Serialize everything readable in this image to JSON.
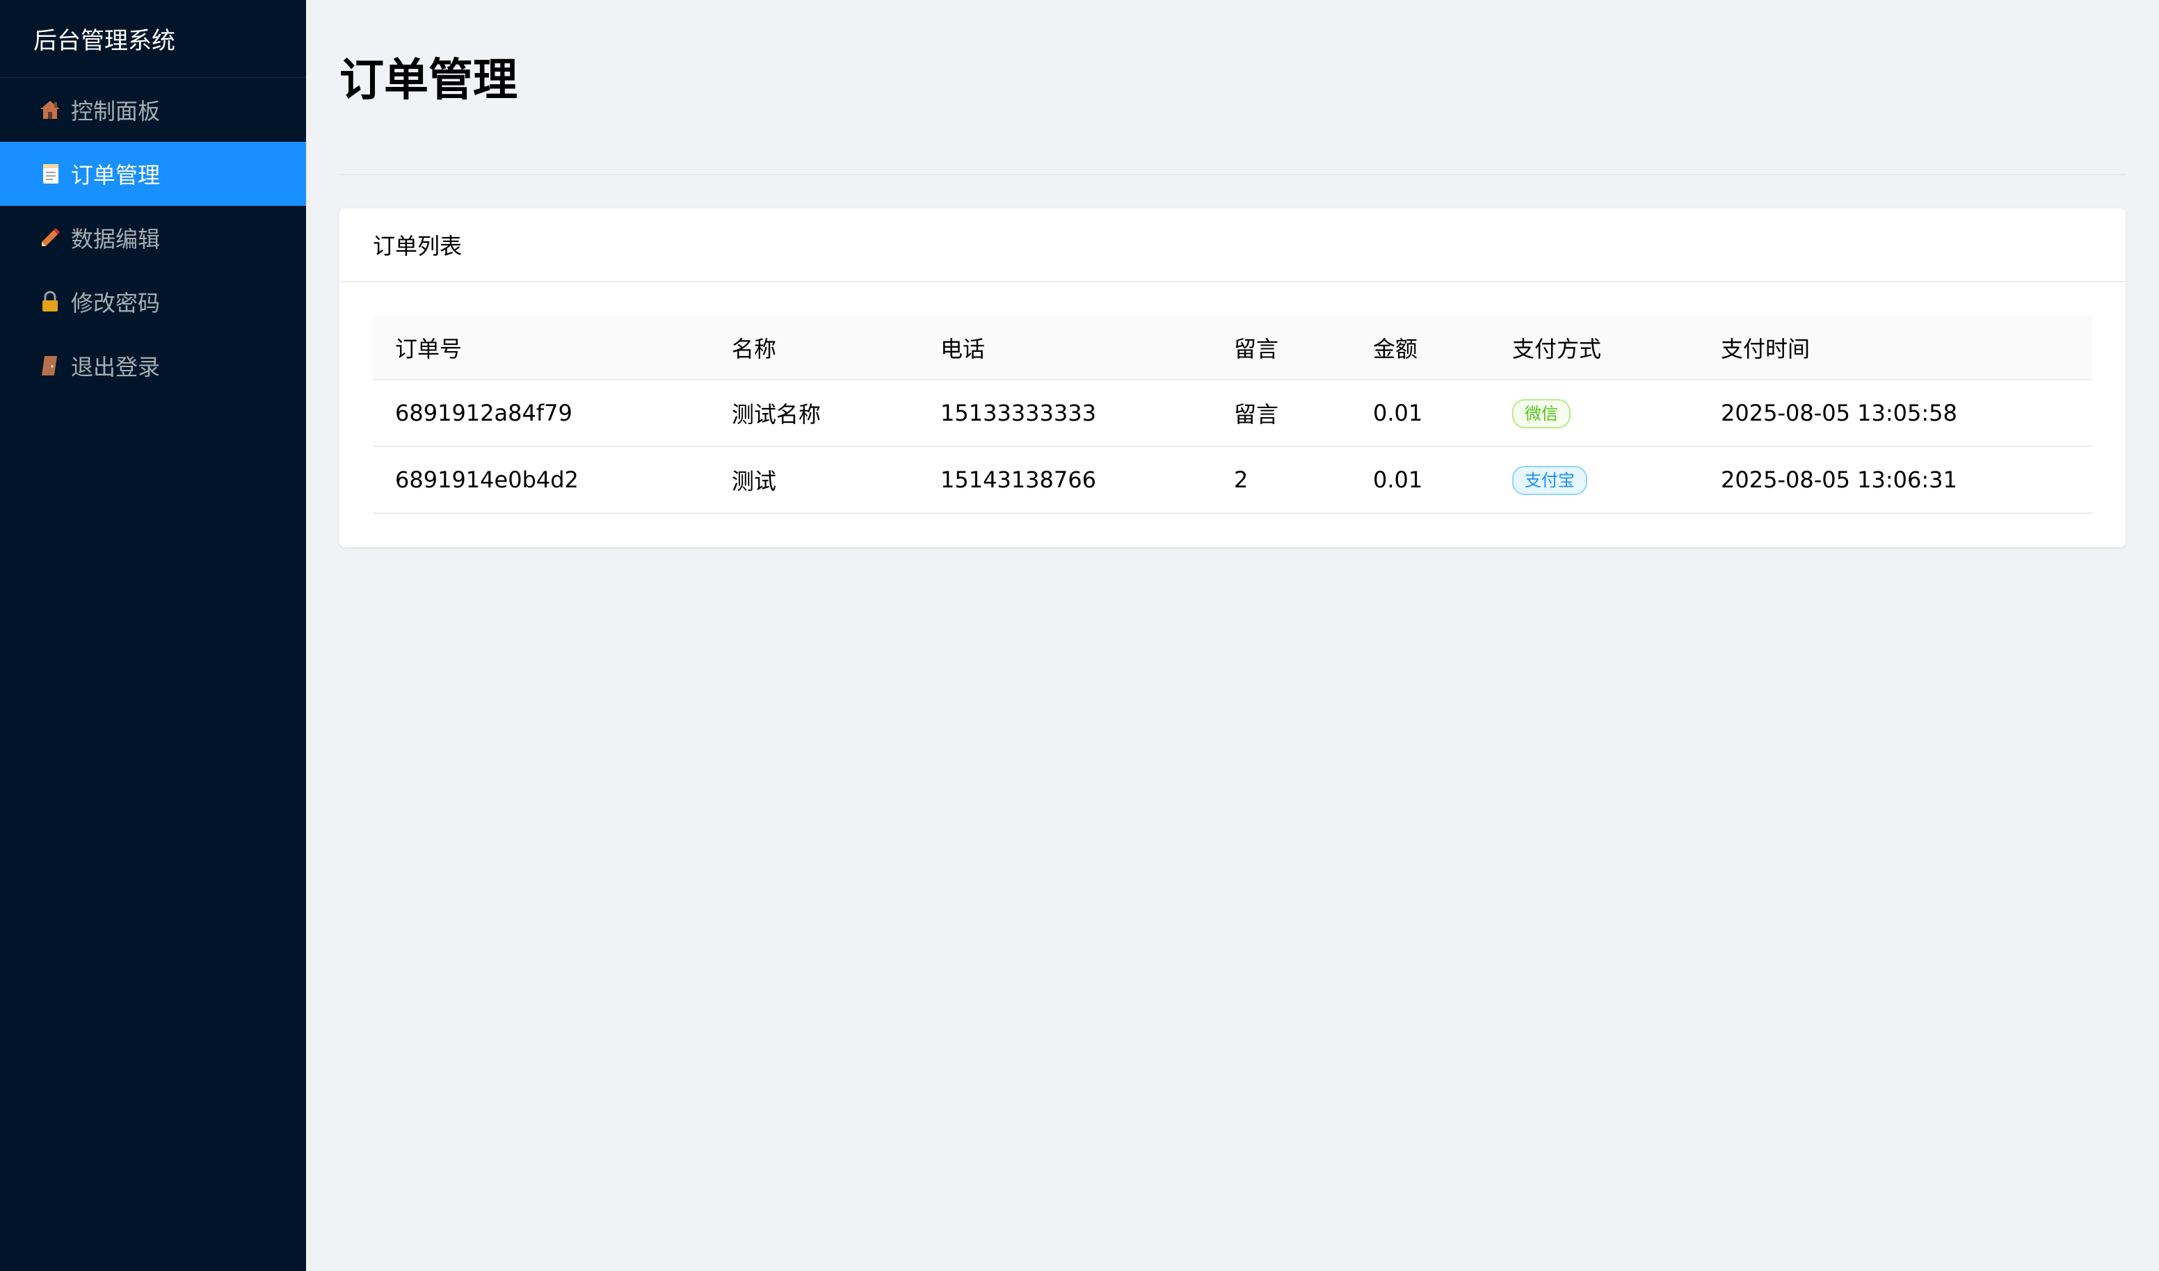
{
  "app": {
    "title": "后台管理系统"
  },
  "sidebar": {
    "items": [
      {
        "label": "控制面板",
        "icon": "house-icon"
      },
      {
        "label": "订单管理",
        "icon": "memo-icon",
        "active": true
      },
      {
        "label": "数据编辑",
        "icon": "pencil-icon"
      },
      {
        "label": "修改密码",
        "icon": "lock-icon"
      },
      {
        "label": "退出登录",
        "icon": "door-icon"
      }
    ]
  },
  "main": {
    "page_title": "订单管理",
    "card_title": "订单列表"
  },
  "table": {
    "headers": [
      "订单号",
      "名称",
      "电话",
      "留言",
      "金额",
      "支付方式",
      "支付时间"
    ],
    "rows": [
      {
        "order_no": "6891912a84f79",
        "name": "测试名称",
        "phone": "15133333333",
        "message": "留言",
        "amount": "0.01",
        "payment": "微信",
        "time": "2025-08-05 13:05:58"
      },
      {
        "order_no": "6891914e0b4d2",
        "name": "测试",
        "phone": "15143138766",
        "message": "2",
        "amount": "0.01",
        "payment": "支付宝",
        "time": "2025-08-05 13:06:31"
      }
    ]
  },
  "colors": {
    "sidebar_bg": "#001529",
    "accent": "#1890ff",
    "wechat": "#52c41a",
    "alipay": "#1890ff"
  }
}
